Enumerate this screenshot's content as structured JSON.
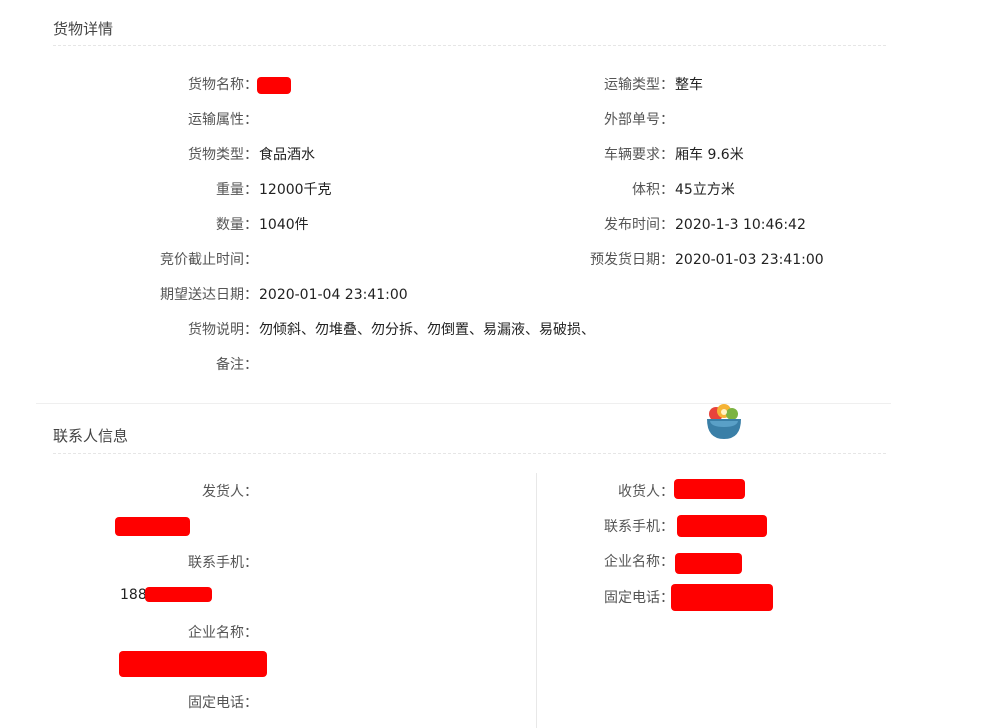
{
  "cargo": {
    "title": "货物详情",
    "left": [
      {
        "label": "货物名称：",
        "value": ""
      },
      {
        "label": "运输属性：",
        "value": ""
      },
      {
        "label": "货物类型：",
        "value": "食品酒水"
      },
      {
        "label": "重量：",
        "value": "12000千克"
      },
      {
        "label": "数量：",
        "value": "1040件"
      },
      {
        "label": "竞价截止时间：",
        "value": ""
      },
      {
        "label": "期望送达日期：",
        "value": "2020-01-04 23:41:00"
      },
      {
        "label": "货物说明：",
        "value": "勿倾斜、勿堆叠、勿分拆、勿倒置、易漏液、易破损、"
      },
      {
        "label": "备注：",
        "value": ""
      }
    ],
    "right": [
      {
        "label": "运输类型：",
        "value": "整车"
      },
      {
        "label": "外部单号：",
        "value": ""
      },
      {
        "label": "车辆要求：",
        "value": "厢车 9.6米"
      },
      {
        "label": "体积：",
        "value": "45立方米"
      },
      {
        "label": "发布时间：",
        "value": "2020-1-3 10:46:42"
      },
      {
        "label": "预发货日期：",
        "value": "2020-01-03 23:41:00"
      }
    ]
  },
  "contact": {
    "title": "联系人信息",
    "sender": {
      "shipper_label": "发货人：",
      "phone_label": "联系手机：",
      "phone_prefix": "188",
      "company_label": "企业名称：",
      "tel_label": "固定电话："
    },
    "receiver": {
      "consignee_label": "收货人：",
      "phone_label": "联系手机：",
      "company_label": "企业名称：",
      "tel_label": "固定电话："
    }
  },
  "colors": {
    "redaction": "#ff0000",
    "divider": "#e6e6e6"
  },
  "icons": {
    "floating": "bowl-icon"
  }
}
